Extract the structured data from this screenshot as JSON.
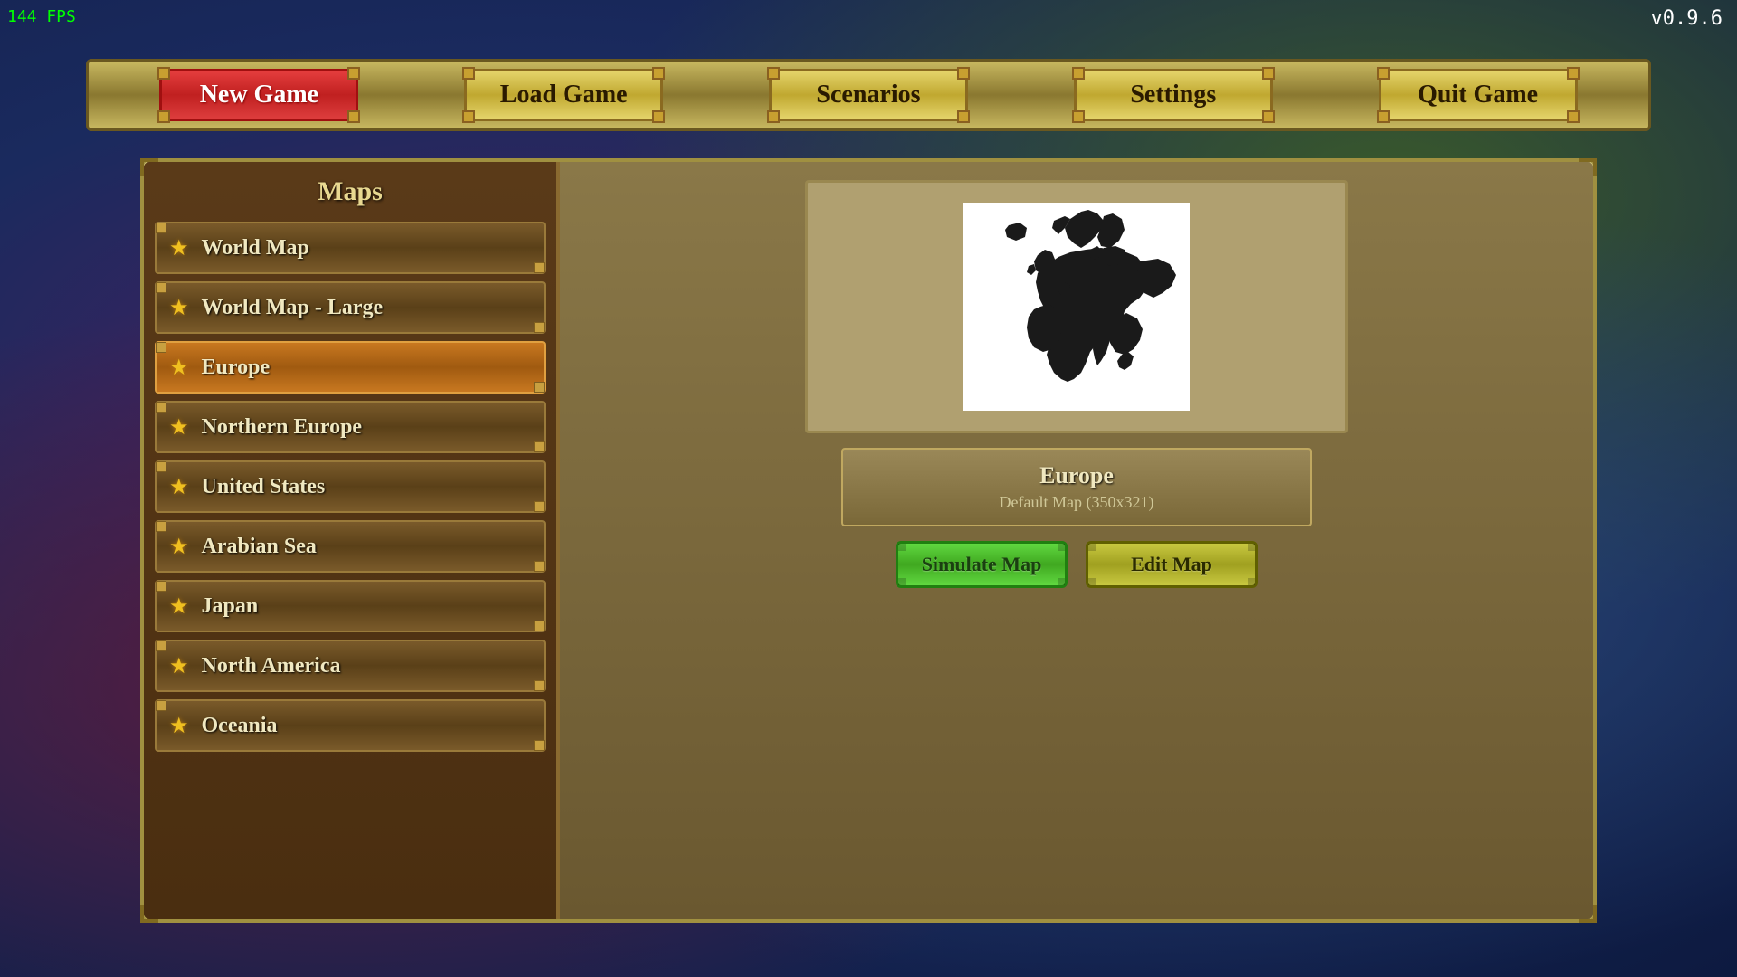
{
  "fps": "144 FPS",
  "version": "v0.9.6",
  "nav": {
    "new_game": "New Game",
    "load_game": "Load Game",
    "scenarios": "Scenarios",
    "settings": "Settings",
    "quit_game": "Quit Game"
  },
  "maps_panel": {
    "title": "Maps",
    "items": [
      {
        "id": "world-map",
        "name": "World Map",
        "active": false
      },
      {
        "id": "world-map-large",
        "name": "World Map - Large",
        "active": false
      },
      {
        "id": "europe",
        "name": "Europe",
        "active": true
      },
      {
        "id": "northern-europe",
        "name": "Northern Europe",
        "active": false
      },
      {
        "id": "united-states",
        "name": "United States",
        "active": false
      },
      {
        "id": "arabian-sea",
        "name": "Arabian Sea",
        "active": false
      },
      {
        "id": "japan",
        "name": "Japan",
        "active": false
      },
      {
        "id": "north-america",
        "name": "North America",
        "active": false
      },
      {
        "id": "oceania",
        "name": "Oceania",
        "active": false
      }
    ]
  },
  "preview": {
    "selected_name": "Europe",
    "selected_desc": "Default Map (350x321)",
    "simulate_label": "Simulate Map",
    "edit_label": "Edit Map"
  }
}
